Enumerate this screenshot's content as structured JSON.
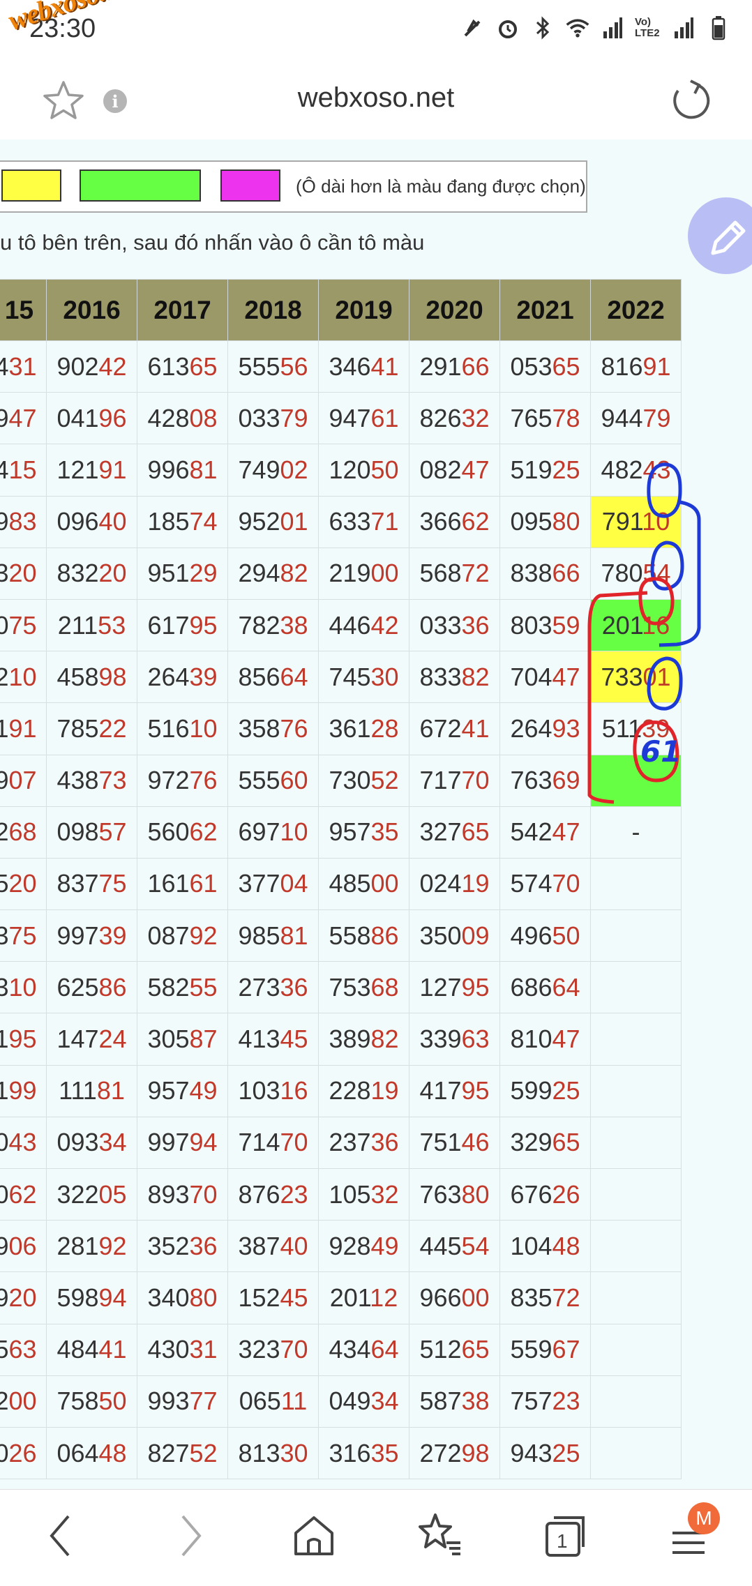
{
  "status": {
    "time": "23:30",
    "watermark": "webxoso.net",
    "volte": "Vo) LTE2"
  },
  "header": {
    "title": "webxoso.net",
    "info_glyph": "i"
  },
  "picker": {
    "note": "(Ô dài hơn là màu đang được chọn)",
    "colors": {
      "yellow": "#ffff44",
      "green": "#66ff44",
      "magenta": "#ee33ee"
    }
  },
  "instruction": "u tô bên trên, sau đó nhấn vào ô cần tô màu",
  "table": {
    "columns": [
      "15",
      "2016",
      "2017",
      "2018",
      "2019",
      "2020",
      "2021",
      "2022"
    ],
    "rows": [
      [
        "431",
        "90242",
        "61365",
        "55556",
        "34641",
        "29166",
        "05365",
        "81691"
      ],
      [
        "947",
        "04196",
        "42808",
        "03379",
        "94761",
        "82632",
        "76578",
        "94479"
      ],
      [
        "415",
        "12191",
        "99681",
        "74902",
        "12050",
        "08247",
        "51925",
        "48243"
      ],
      [
        "983",
        "09640",
        "18574",
        "95201",
        "63371",
        "36662",
        "09580",
        "79110"
      ],
      [
        "320",
        "83220",
        "95129",
        "29482",
        "21900",
        "56872",
        "83866",
        "78054"
      ],
      [
        "075",
        "21153",
        "61795",
        "78238",
        "44642",
        "03336",
        "80359",
        "20116"
      ],
      [
        "210",
        "45898",
        "26439",
        "85664",
        "74530",
        "83382",
        "70447",
        "73301"
      ],
      [
        "191",
        "78522",
        "51610",
        "35876",
        "36128",
        "67241",
        "26493",
        "51139"
      ],
      [
        "907",
        "43873",
        "97276",
        "55560",
        "73052",
        "71770",
        "76369",
        ""
      ],
      [
        "268",
        "09857",
        "56062",
        "69710",
        "95735",
        "32765",
        "54247",
        "-"
      ],
      [
        "520",
        "83775",
        "16161",
        "37704",
        "48500",
        "02419",
        "57470",
        ""
      ],
      [
        "375",
        "99739",
        "08792",
        "98581",
        "55886",
        "35009",
        "49650",
        ""
      ],
      [
        "310",
        "62586",
        "58255",
        "27336",
        "75368",
        "12795",
        "68664",
        ""
      ],
      [
        "195",
        "14724",
        "30587",
        "41345",
        "38982",
        "33963",
        "81047",
        ""
      ],
      [
        "199",
        "11181",
        "95749",
        "10316",
        "22819",
        "41795",
        "59925",
        ""
      ],
      [
        "043",
        "09334",
        "99794",
        "71470",
        "23736",
        "75146",
        "32965",
        ""
      ],
      [
        "062",
        "32205",
        "89370",
        "87623",
        "10532",
        "76380",
        "67626",
        ""
      ],
      [
        "906",
        "28192",
        "35236",
        "38740",
        "92849",
        "44554",
        "10448",
        ""
      ],
      [
        "920",
        "59894",
        "34080",
        "15245",
        "20112",
        "96600",
        "83572",
        ""
      ],
      [
        "563",
        "48441",
        "43031",
        "32370",
        "43464",
        "51265",
        "55967",
        ""
      ],
      [
        "200",
        "75850",
        "99377",
        "06511",
        "04934",
        "58738",
        "75723",
        ""
      ],
      [
        "026",
        "06448",
        "82752",
        "81330",
        "31635",
        "27298",
        "94325",
        ""
      ]
    ],
    "highlights": [
      {
        "row": 3,
        "col": 7,
        "color": "yellow"
      },
      {
        "row": 5,
        "col": 7,
        "color": "green"
      },
      {
        "row": 6,
        "col": 7,
        "color": "yellow"
      },
      {
        "row": 8,
        "col": 7,
        "color": "green"
      }
    ]
  },
  "annotation": {
    "handwritten": "61"
  },
  "nav": {
    "tabs_count": "1",
    "profile_initial": "M"
  }
}
